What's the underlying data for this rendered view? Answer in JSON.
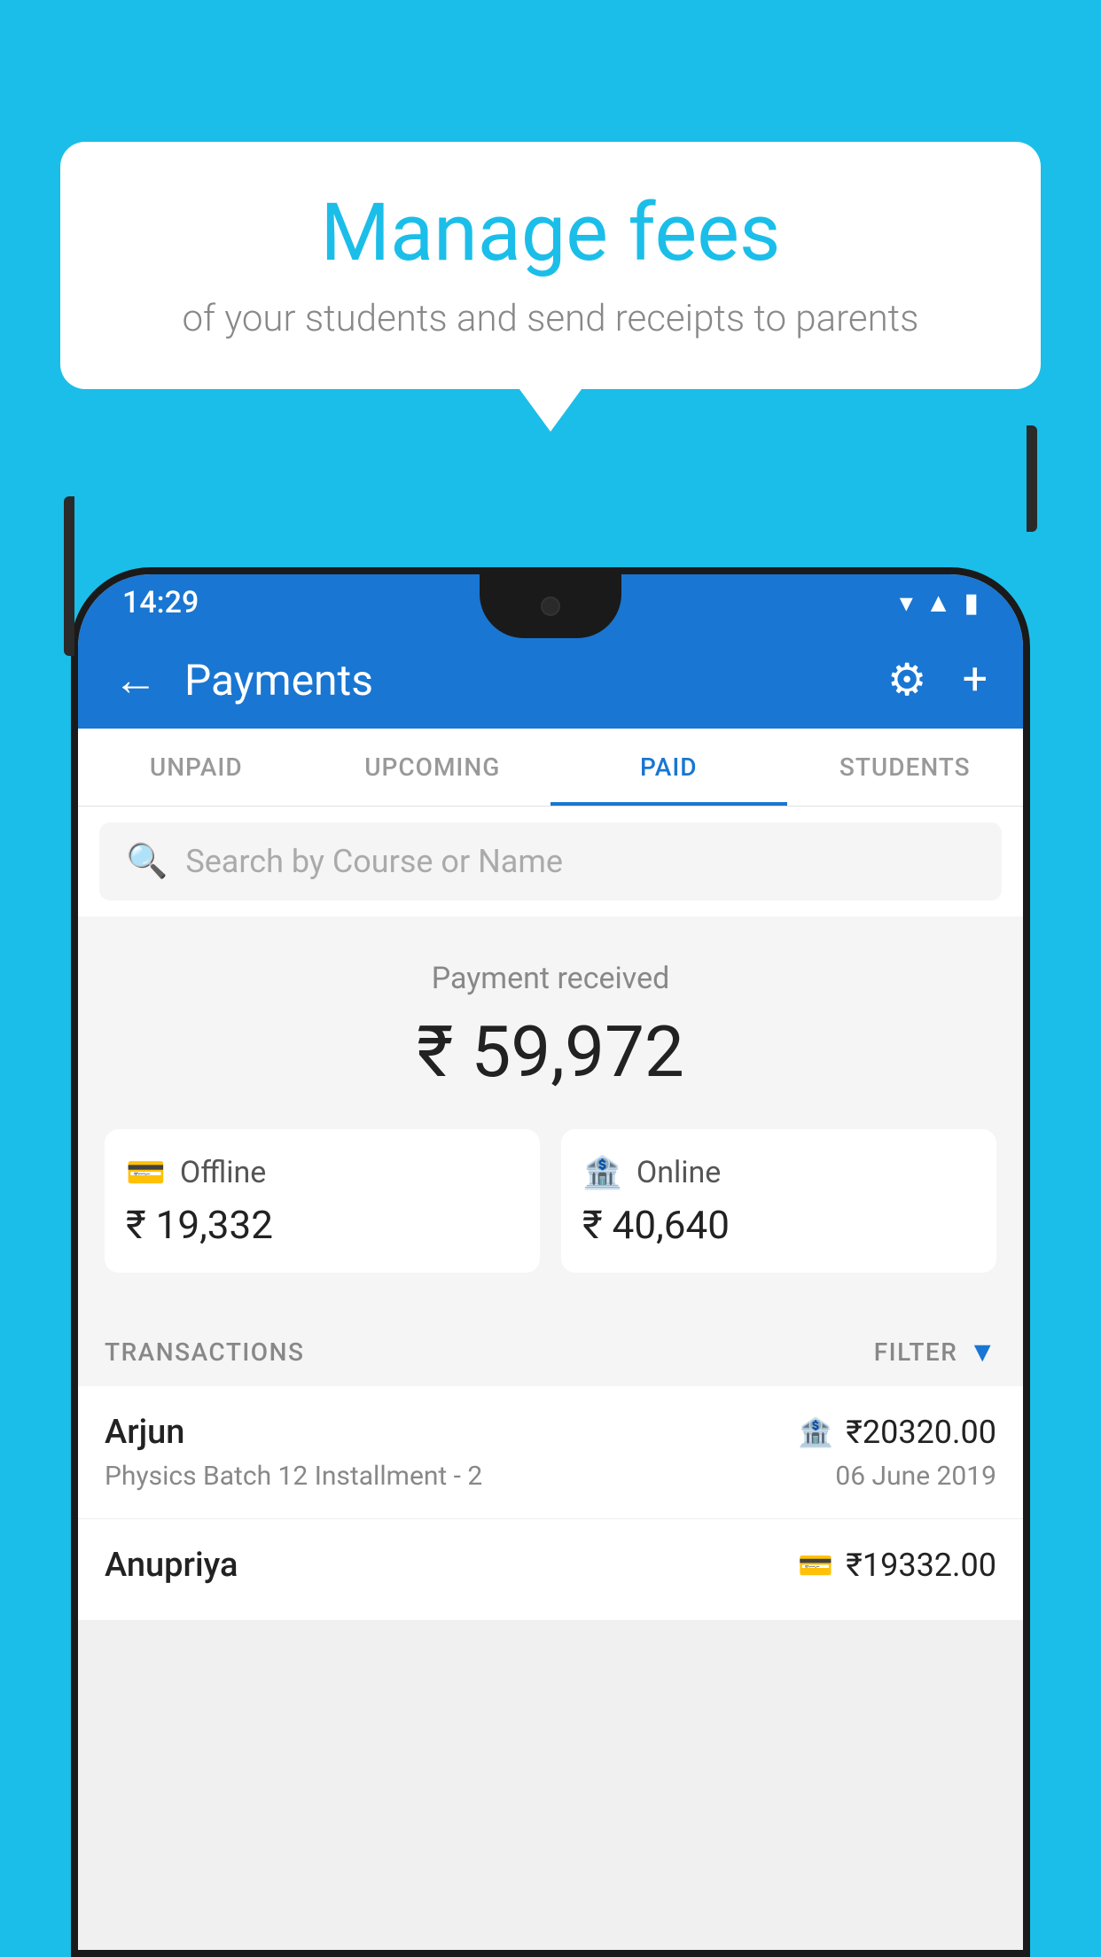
{
  "background_color": "#1BBEE8",
  "speech_bubble": {
    "title": "Manage fees",
    "subtitle": "of your students and send receipts to parents"
  },
  "status_bar": {
    "time": "14:29",
    "icons": [
      "wifi",
      "signal",
      "battery"
    ]
  },
  "app_bar": {
    "title": "Payments",
    "back_label": "←",
    "settings_label": "⚙",
    "add_label": "+"
  },
  "tabs": [
    {
      "label": "UNPAID",
      "active": false
    },
    {
      "label": "UPCOMING",
      "active": false
    },
    {
      "label": "PAID",
      "active": true
    },
    {
      "label": "STUDENTS",
      "active": false
    }
  ],
  "search": {
    "placeholder": "Search by Course or Name"
  },
  "payment_summary": {
    "label": "Payment received",
    "amount": "₹ 59,972",
    "offline": {
      "type": "Offline",
      "amount": "₹ 19,332"
    },
    "online": {
      "type": "Online",
      "amount": "₹ 40,640"
    }
  },
  "transactions_section": {
    "label": "TRANSACTIONS",
    "filter_label": "FILTER"
  },
  "transactions": [
    {
      "name": "Arjun",
      "course": "Physics Batch 12 Installment - 2",
      "amount": "₹20320.00",
      "date": "06 June 2019",
      "type": "online"
    },
    {
      "name": "Anupriya",
      "course": "",
      "amount": "₹19332.00",
      "date": "",
      "type": "offline"
    }
  ]
}
